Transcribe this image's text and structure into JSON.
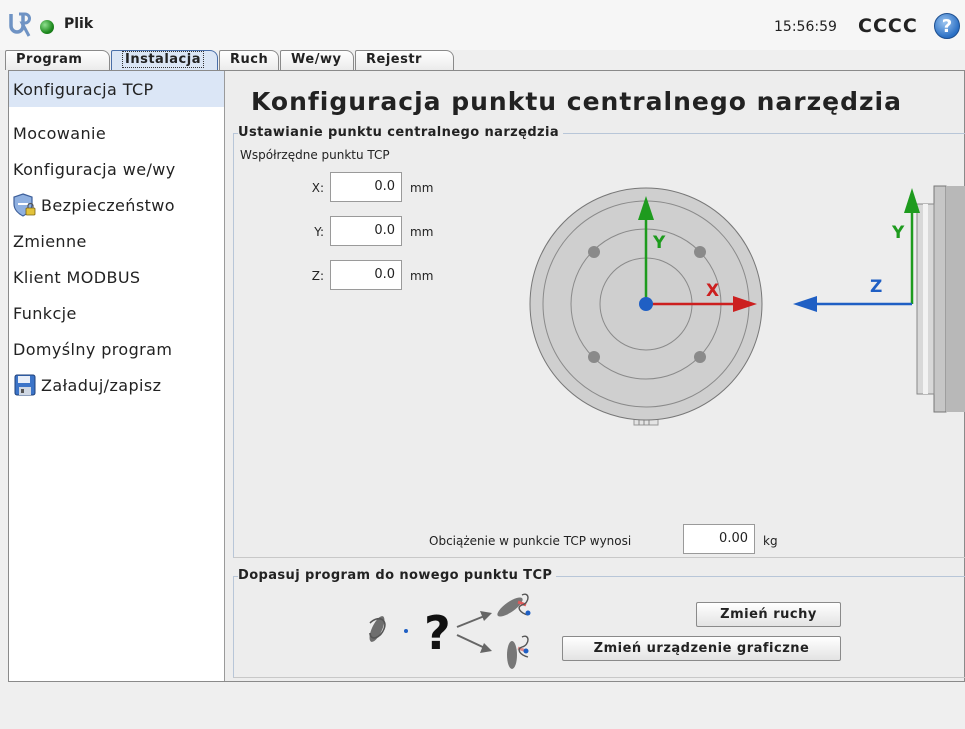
{
  "app": {
    "menu_label": "Plik",
    "clock": "15:56:59",
    "robot_name": "CCCC",
    "help_symbol": "?"
  },
  "tabs": [
    {
      "label": "Program",
      "active": false
    },
    {
      "label": "Instalacja",
      "active": true
    },
    {
      "label": "Ruch",
      "active": false
    },
    {
      "label": "We/wy",
      "active": false
    },
    {
      "label": "Rejestr",
      "active": false
    }
  ],
  "sidebar": {
    "items": [
      {
        "label": "Konfiguracja TCP",
        "active": true,
        "icon": null
      },
      {
        "label": "Mocowanie",
        "active": false,
        "icon": null
      },
      {
        "label": "Konfiguracja we/wy",
        "active": false,
        "icon": null
      },
      {
        "label": "Bezpieczeństwo",
        "active": false,
        "icon": "shield-lock-icon"
      },
      {
        "label": "Zmienne",
        "active": false,
        "icon": null
      },
      {
        "label": "Klient MODBUS",
        "active": false,
        "icon": null
      },
      {
        "label": "Funkcje",
        "active": false,
        "icon": null
      },
      {
        "label": "Domyślny program",
        "active": false,
        "icon": null
      },
      {
        "label": "Załaduj/zapisz",
        "active": false,
        "icon": "floppy-disk-icon"
      }
    ]
  },
  "main": {
    "title": "Konfiguracja punktu centralnego narzędzia",
    "tcp_group": {
      "label": "Ustawianie punktu centralnego narzędzia",
      "coords_label": "Współrzędne punktu TCP",
      "fields": [
        {
          "label": "X:",
          "value": "0.0",
          "unit": "mm"
        },
        {
          "label": "Y:",
          "value": "0.0",
          "unit": "mm"
        },
        {
          "label": "Z:",
          "value": "0.0",
          "unit": "mm"
        }
      ],
      "diagram": {
        "front_axes": {
          "x": "X",
          "y": "Y"
        },
        "side_axes": {
          "y": "Y",
          "z": "Z"
        }
      },
      "payload": {
        "label": "Obciążenie w punkcie TCP wynosi",
        "value": "0.00",
        "unit": "kg"
      }
    },
    "adjust_group": {
      "label": "Dopasuj program do nowego punktu TCP",
      "question_mark": "?",
      "change_moves_button": "Zmień ruchy",
      "change_graphics_button": "Zmień urządzenie graficzne"
    }
  },
  "colors": {
    "x_axis": "#cc1f1f",
    "y_axis": "#1e9b1e",
    "z_axis": "#1f5fc4",
    "selected_bg": "#dbe6f6"
  }
}
